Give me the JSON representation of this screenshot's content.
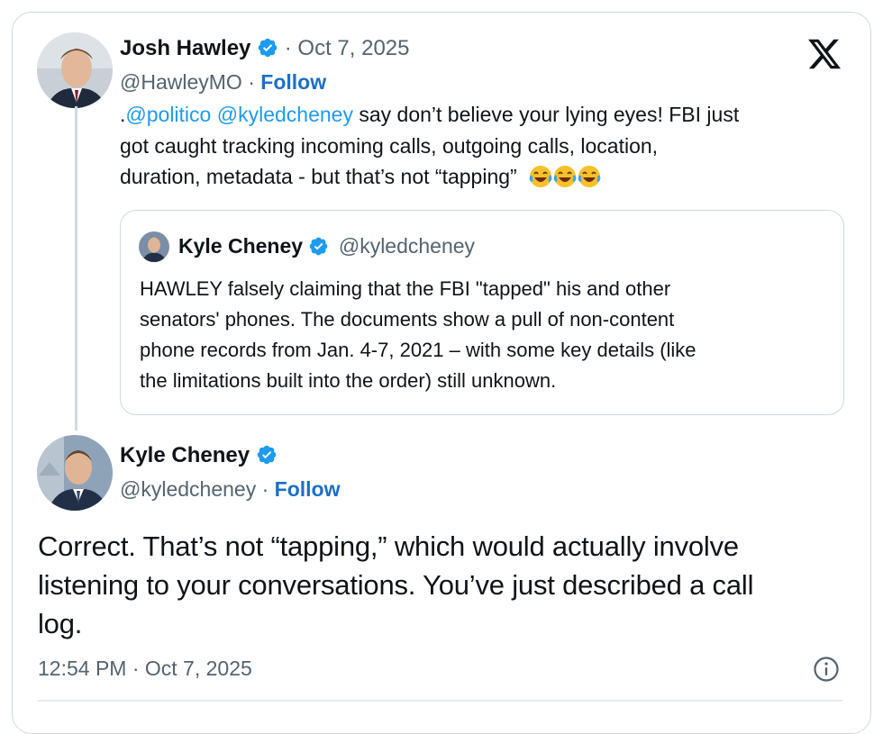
{
  "parent_tweet": {
    "author_name": "Josh Hawley",
    "date_sep": "·",
    "date": "Oct 7, 2025",
    "handle": "@HawleyMO",
    "handle_sep": "·",
    "follow": "Follow",
    "text_prefix": ".",
    "mention1": "@politico",
    "mention2": "@kyledcheney",
    "text_line1_rest": " say don’t believe your lying eyes! FBI just",
    "text_line2": "got caught tracking incoming calls, outgoing calls, location,",
    "text_line3": "duration, metadata - but that’s not “tapping”",
    "emoji": "face-with-tears-of-joy x3"
  },
  "quoted_tweet": {
    "author_name": "Kyle Cheney",
    "handle": "@kyledcheney",
    "lines": [
      "HAWLEY falsely claiming that the FBI \"tapped\" his and other",
      "senators' phones. The documents show a pull of non-content",
      "phone records from Jan. 4-7, 2021 – with some key details (like",
      "the limitations built into the order) still unknown."
    ]
  },
  "main_tweet": {
    "author_name": "Kyle Cheney",
    "handle": "@kyledcheney",
    "handle_sep": "·",
    "follow": "Follow",
    "lines": [
      "Correct. That’s not “tapping,” which would actually involve",
      "listening to your conversations. You’ve just described a call",
      "log."
    ],
    "timestamp": "12:54 PM · Oct 7, 2025"
  },
  "icons": {
    "logo": "x-logo-icon",
    "verified": "verified-badge-icon",
    "info": "info-icon"
  },
  "colors": {
    "link": "#1d9bf0",
    "verified": "#1d9bf0",
    "muted": "#536471",
    "border": "#cfd9de"
  }
}
